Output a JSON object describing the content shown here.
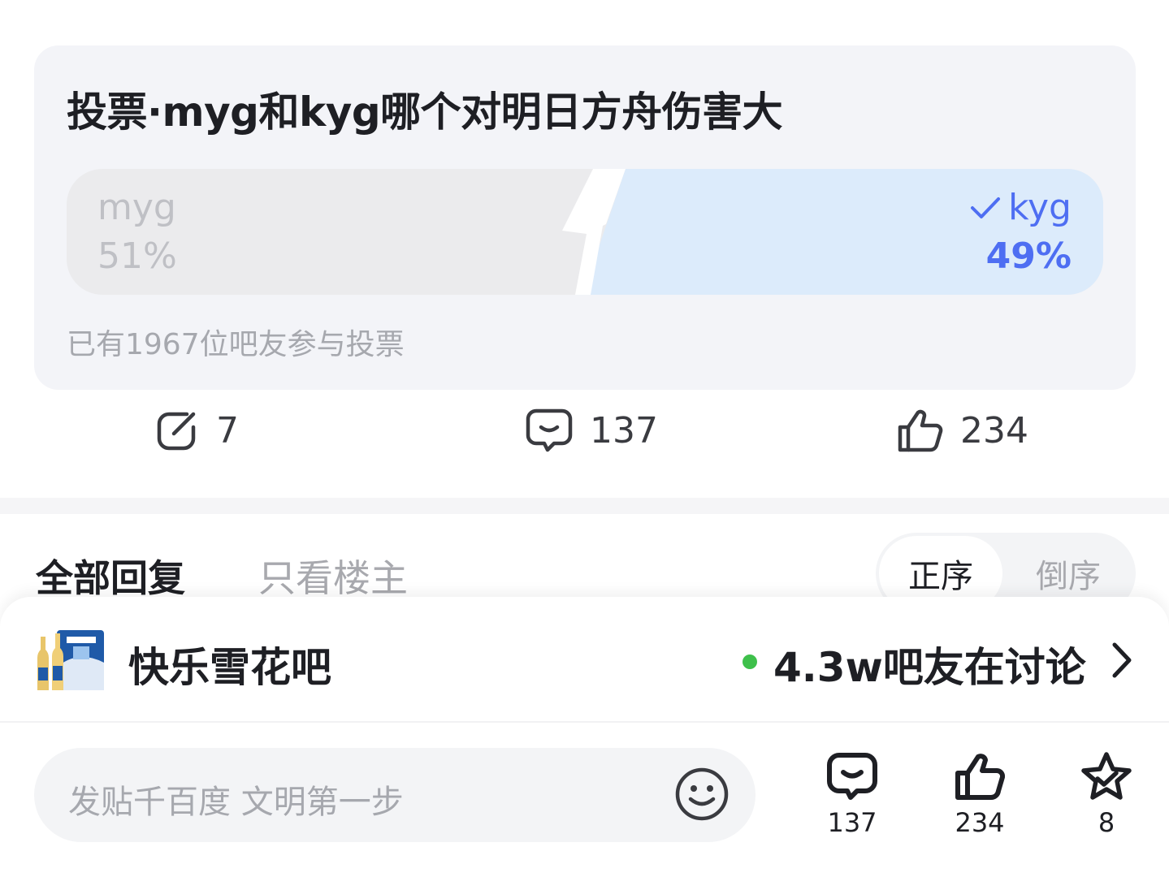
{
  "vote": {
    "title": "投票·myg和kyg哪个对明日方舟伤害大",
    "option_a": {
      "name": "myg",
      "percent_label": "51%",
      "percent": 51,
      "selected": false
    },
    "option_b": {
      "name": "kyg",
      "percent_label": "49%",
      "percent": 49,
      "selected": true
    },
    "participants_text": "已有1967位吧友参与投票",
    "colors": {
      "option_a_fill": "#ebebed",
      "option_b_fill": "#dcebfb",
      "accent": "#4e6ef2"
    }
  },
  "actions": {
    "share": {
      "icon": "share-icon",
      "count": "7"
    },
    "comment": {
      "icon": "comment-icon",
      "count": "137"
    },
    "like": {
      "icon": "thumbs-up-icon",
      "count": "234"
    }
  },
  "tabs": {
    "all_replies": "全部回复",
    "owner_only": "只看楼主",
    "sort_asc": "正序",
    "sort_desc": "倒序",
    "active_sort": "正序"
  },
  "forum": {
    "name": "快乐雪花吧",
    "online_text": "4.3w吧友在讨论",
    "online_color": "#3ec04b"
  },
  "bottom_bar": {
    "input_placeholder": "发贴千百度 文明第一步",
    "comment_count": "137",
    "like_count": "234",
    "favorite_count": "8"
  }
}
